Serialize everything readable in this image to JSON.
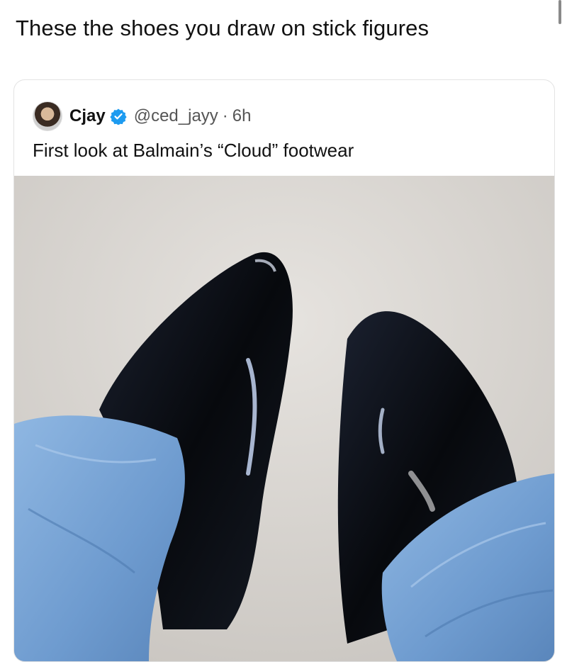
{
  "post": {
    "caption": "These the shoes you draw on stick figures"
  },
  "quoted_tweet": {
    "avatar_icon": "user-avatar",
    "display_name": "Cjay",
    "verified_icon": "verified-badge-icon",
    "handle": "@ced_jayy",
    "separator": "·",
    "time": "6h",
    "text": "First look at Balmain’s “Cloud” footwear",
    "media_description_icon": "photo-black-patent-boots-jeans"
  },
  "colors": {
    "verified_blue": "#1d9bf0",
    "text": "#111111",
    "secondary_text": "#555555",
    "denim": "#7aa6d6",
    "carpet": "#d9d6d2",
    "boot": "#0b0d12"
  }
}
